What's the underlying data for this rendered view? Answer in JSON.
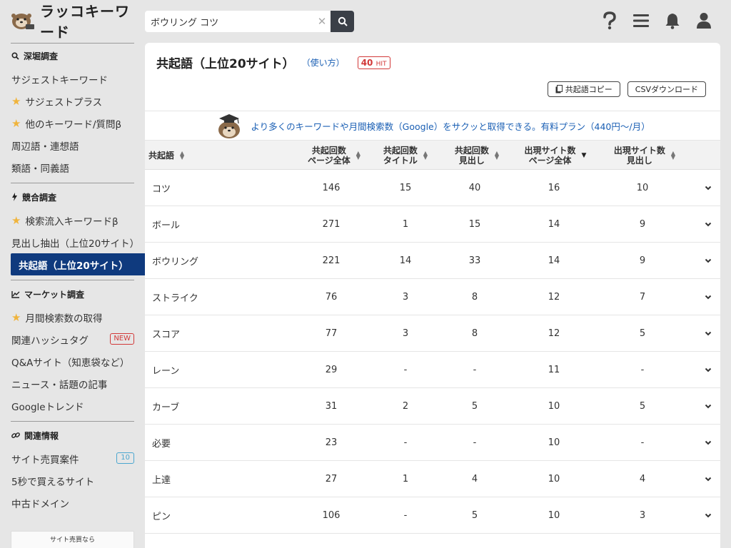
{
  "brand": {
    "name": "ラッコキーワード"
  },
  "search": {
    "value": "ボウリング コツ"
  },
  "sidebar": {
    "sections": [
      {
        "title": "深堀調査",
        "icon": "search-icon",
        "items": [
          {
            "label": "サジェストキーワード",
            "star": false
          },
          {
            "label": "サジェストプラス",
            "star": true
          },
          {
            "label": "他のキーワード/質問β",
            "star": true
          },
          {
            "label": "周辺語・連想語",
            "star": false
          },
          {
            "label": "類語・同義語",
            "star": false
          }
        ]
      },
      {
        "title": "競合調査",
        "icon": "lightning-icon",
        "items": [
          {
            "label": "検索流入キーワードβ",
            "star": true
          },
          {
            "label": "見出し抽出（上位20サイト）",
            "star": false
          },
          {
            "label": "共起語（上位20サイト）",
            "star": false,
            "active": true
          }
        ]
      },
      {
        "title": "マーケット調査",
        "icon": "chart-icon",
        "items": [
          {
            "label": "月間検索数の取得",
            "star": true
          },
          {
            "label": "関連ハッシュタグ",
            "star": false,
            "badge": "NEW"
          },
          {
            "label": "Q&Aサイト（知恵袋など）",
            "star": false
          },
          {
            "label": "ニュース・話題の記事",
            "star": false
          },
          {
            "label": "Googleトレンド",
            "star": false
          }
        ]
      },
      {
        "title": "関連情報",
        "icon": "link-icon",
        "items": [
          {
            "label": "サイト売買案件",
            "star": false,
            "count": "10"
          },
          {
            "label": "5秒で買えるサイト",
            "star": false
          },
          {
            "label": "中古ドメイン",
            "star": false
          }
        ]
      }
    ],
    "banner_text": "サイト売買なら"
  },
  "main": {
    "title": "共起語（上位20サイト）",
    "howto": "（使い方）",
    "hit_count": "40",
    "hit_label": "HIT",
    "copy_button": "共起語コピー",
    "csv_button": "CSVダウンロード",
    "promo_text": "より多くのキーワードや月間検索数（Google）をサクッと取得できる。有料プラン（440円〜/月）"
  },
  "table": {
    "headers": [
      {
        "line1": "共起語",
        "line2": ""
      },
      {
        "line1": "共起回数",
        "line2": "ページ全体"
      },
      {
        "line1": "共起回数",
        "line2": "タイトル"
      },
      {
        "line1": "共起回数",
        "line2": "見出し"
      },
      {
        "line1": "出現サイト数",
        "line2": "ページ全体"
      },
      {
        "line1": "出現サイト数",
        "line2": "見出し"
      }
    ],
    "rows": [
      [
        "コツ",
        "146",
        "15",
        "40",
        "16",
        "10"
      ],
      [
        "ボール",
        "271",
        "1",
        "15",
        "14",
        "9"
      ],
      [
        "ボウリング",
        "221",
        "14",
        "33",
        "14",
        "9"
      ],
      [
        "ストライク",
        "76",
        "3",
        "8",
        "12",
        "7"
      ],
      [
        "スコア",
        "77",
        "3",
        "8",
        "12",
        "5"
      ],
      [
        "レーン",
        "29",
        "-",
        "-",
        "11",
        "-"
      ],
      [
        "カーブ",
        "31",
        "2",
        "5",
        "10",
        "5"
      ],
      [
        "必要",
        "23",
        "-",
        "-",
        "10",
        "-"
      ],
      [
        "上達",
        "27",
        "1",
        "4",
        "10",
        "4"
      ],
      [
        "ピン",
        "106",
        "-",
        "5",
        "10",
        "3"
      ]
    ]
  },
  "colors": {
    "accent": "#0f3a7e",
    "link": "#1a5fb4",
    "star": "#f0b43c",
    "badge_red": "#d23838",
    "badge_blue": "#4aa6cf"
  }
}
